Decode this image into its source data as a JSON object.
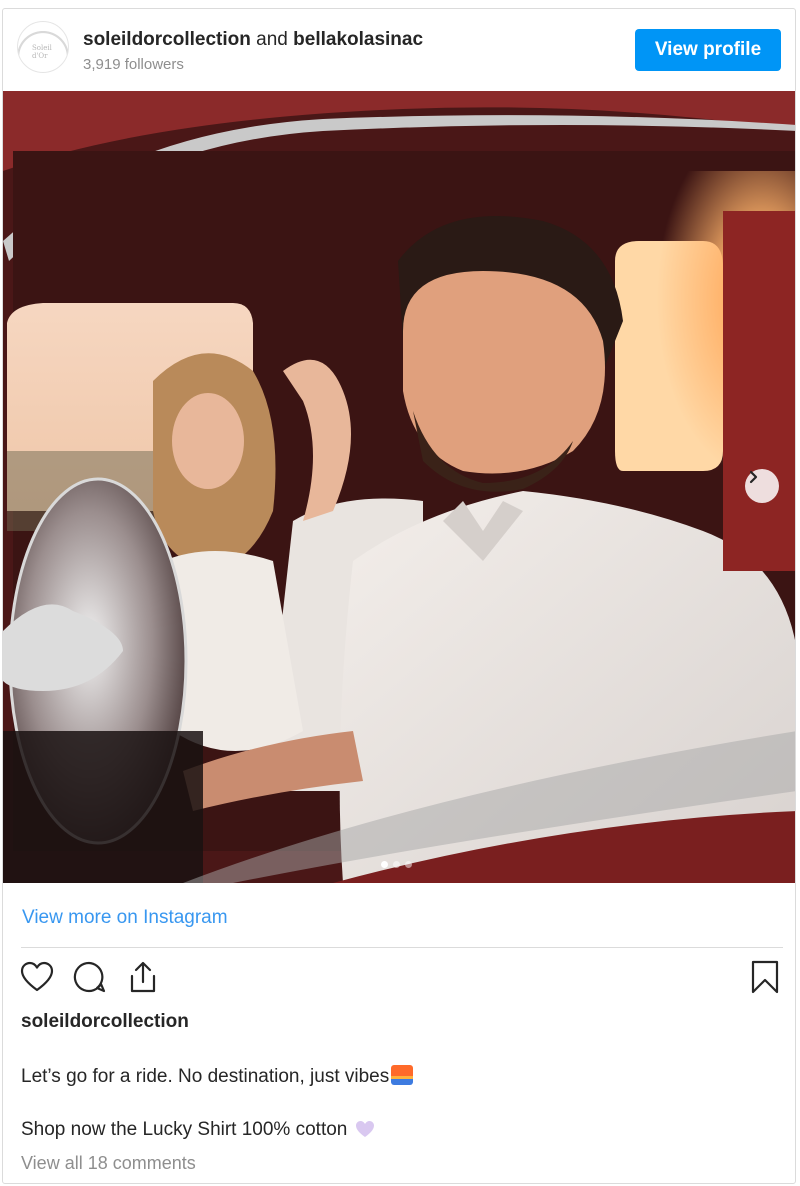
{
  "header": {
    "account_primary": "soleildorcollection",
    "connector": "and",
    "account_secondary": "bellakolasinac",
    "followers": "3,919 followers",
    "avatar_text": "Soleil d'Or",
    "view_profile_label": "View profile"
  },
  "photo": {
    "slide_count": 3,
    "active_slide": 1
  },
  "post": {
    "view_more_label": "View more on Instagram",
    "owner": "soleildorcollection",
    "caption_line1": "Let’s go for a ride. No destination, just vibes",
    "caption_line2": "Shop now the Lucky Shirt 100% cotton",
    "comments_label": "View all 18 comments"
  },
  "icons": {
    "like": "heart-icon",
    "comment": "comment-icon",
    "share": "share-icon",
    "save": "bookmark-icon",
    "next": "chevron-right-icon"
  },
  "colors": {
    "accent": "#0095f6",
    "link": "#3897f0",
    "muted": "#8e8e8e"
  }
}
